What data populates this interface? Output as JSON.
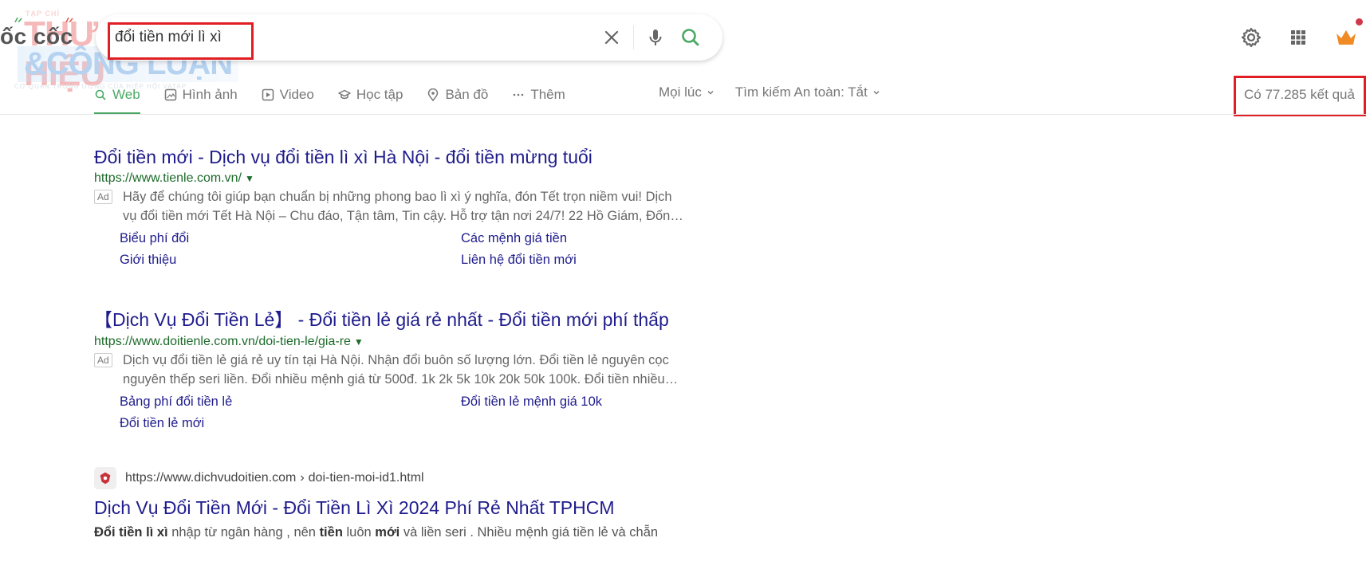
{
  "brand": {
    "logo_text": "ốc cốc",
    "watermark_small": "TẠP CHÍ",
    "watermark_top": "THƯƠNG HIỆU",
    "watermark_mid": "&CÔNG LUẬN",
    "watermark_sub": "CƠ QUAN TRUNG ƯƠNG CỦA HIỆP HỘI VATAP"
  },
  "search": {
    "query": "đổi tiền mới lì xì",
    "clear_icon": "close-icon",
    "mic_icon": "microphone-icon",
    "submit_icon": "search-icon"
  },
  "header_icons": [
    "gear-icon",
    "apps-grid-icon",
    "crown-icon"
  ],
  "colors": {
    "accent_green": "#4aa865",
    "link_blue": "#1f1c8c",
    "url_green": "#1c6b2a",
    "highlight_red": "#e01e24",
    "crown_orange": "#f08a24",
    "notification_red": "#d0384a"
  },
  "tabs": [
    {
      "label": "Web",
      "icon": "search-icon",
      "active": true
    },
    {
      "label": "Hình ảnh",
      "icon": "image-icon",
      "active": false
    },
    {
      "label": "Video",
      "icon": "play-icon",
      "active": false
    },
    {
      "label": "Học tập",
      "icon": "graduation-cap-icon",
      "active": false
    },
    {
      "label": "Bản đồ",
      "icon": "map-pin-icon",
      "active": false
    },
    {
      "label": "Thêm",
      "icon": "more-dots-icon",
      "active": false
    }
  ],
  "filters": [
    {
      "label": "Mọi lúc"
    },
    {
      "label": "Tìm kiếm An toàn: Tắt"
    }
  ],
  "result_count": "Có 77.285 kết quả",
  "results": [
    {
      "type": "ad",
      "title": "Đổi tiền mới - Dịch vụ đổi tiền lì xì Hà Nội - đổi tiền mừng tuổi",
      "url": "https://www.tienle.com.vn/",
      "url_arrow": "▼",
      "badge": "Ad",
      "description": "Hãy để chúng tôi giúp bạn chuẩn bị những phong bao lì xì ý nghĩa, đón Tết trọn niềm vui! Dịch vụ đổi tiền mới Tết Hà Nội – Chu đáo, Tận tâm, Tin cậy. Hỗ trợ tận nơi 24/7! 22 Hồ Giám, Đốn…",
      "desc_line1": "Hãy để chúng tôi giúp bạn chuẩn bị những phong bao lì xì ý nghĩa, đón Tết trọn niềm vui! Dịch",
      "desc_line2": "vụ đổi tiền mới Tết Hà Nội – Chu đáo, Tận tâm, Tin cậy. Hỗ trợ tận nơi 24/7! 22 Hồ Giám, Đốn…",
      "sitelinks": [
        "Biểu phí đổi",
        "Các mệnh giá tiền",
        "Giới thiệu",
        "Liên hệ đổi tiền mới"
      ]
    },
    {
      "type": "ad",
      "title": "【Dịch Vụ Đổi Tiền Lẻ】 - Đổi tiền lẻ giá rẻ nhất - Đổi tiền mới phí thấp",
      "url": "https://www.doitienle.com.vn/doi-tien-le/gia-re",
      "url_arrow": "▼",
      "badge": "Ad",
      "desc_line1": "Dịch vụ đổi tiền lẻ giá rẻ uy tín tại Hà Nội. Nhận đổi buôn số lượng lớn. Đổi tiền lẻ nguyên cọc",
      "desc_line2": "nguyên thếp seri liền. Đổi nhiều mệnh giá từ 500đ. 1k 2k 5k 10k 20k 50k 100k. Đổi tiền nhiều…",
      "sitelinks": [
        "Bảng phí đổi tiền lẻ",
        "Đổi tiền lẻ mệnh giá 10k",
        "Đổi tiền lẻ mới"
      ]
    },
    {
      "type": "organic",
      "favicon": "site-favicon-icon",
      "url_domain": "https://www.dichvudoitien.com",
      "url_sep": "›",
      "url_path": "doi-tien-moi-id1.html",
      "title": "Dịch Vụ Đổi Tiền Mới - Đổi Tiền Lì Xì 2024 Phí Rẻ Nhất TPHCM",
      "desc_parts": [
        {
          "text": "Đổi tiền lì xì",
          "bold": true
        },
        {
          "text": " nhập từ ngân hàng , nên ",
          "bold": false
        },
        {
          "text": "tiền",
          "bold": true
        },
        {
          "text": " luôn ",
          "bold": false
        },
        {
          "text": "mới",
          "bold": true
        },
        {
          "text": " và liền seri . Nhiều mệnh giá tiền lẻ và chẵn",
          "bold": false
        }
      ]
    }
  ]
}
